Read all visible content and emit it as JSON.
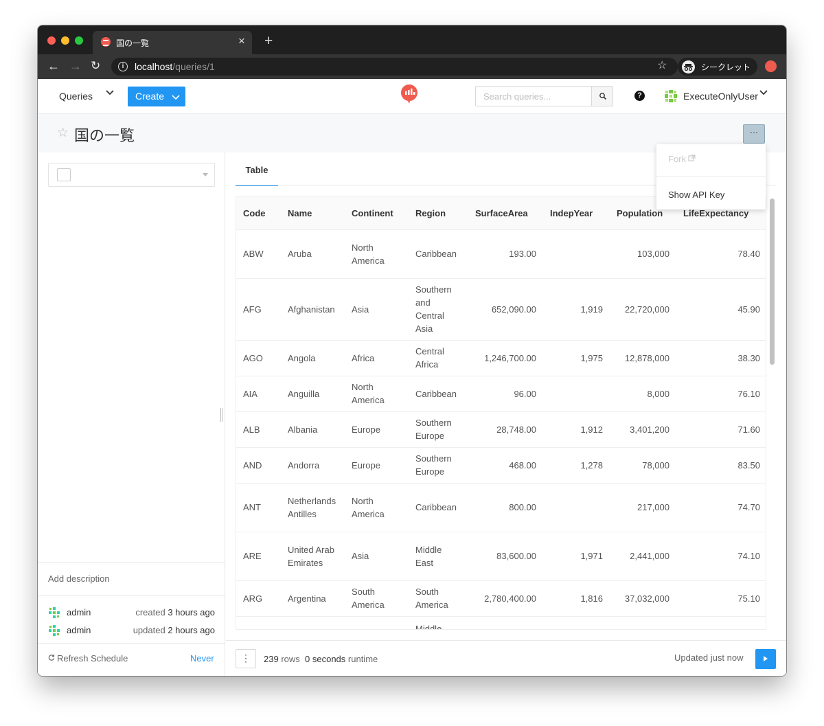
{
  "browser": {
    "tab_title": "国の一覧",
    "tab_close": "×",
    "new_tab": "+",
    "url_host": "localhost",
    "url_path": "/queries/1",
    "incognito_label": "シークレット"
  },
  "header": {
    "queries_label": "Queries",
    "create_label": "Create",
    "search_placeholder": "Search queries...",
    "help_glyph": "?",
    "user_name": "ExecuteOnlyUser"
  },
  "query": {
    "title": "国の一覧",
    "more_label": "···",
    "menu": {
      "fork": "Fork",
      "show_api_key": "Show API Key"
    }
  },
  "sidebar": {
    "add_description": "Add description",
    "created": {
      "user": "admin",
      "action": "created",
      "time": "3 hours ago"
    },
    "updated": {
      "user": "admin",
      "action": "updated",
      "time": "2 hours ago"
    },
    "refresh_label": "Refresh Schedule",
    "refresh_value": "Never"
  },
  "results": {
    "tab_label": "Table",
    "columns": [
      "Code",
      "Name",
      "Continent",
      "Region",
      "SurfaceArea",
      "IndepYear",
      "Population",
      "LifeExpectancy"
    ],
    "rows": [
      [
        "ABW",
        "Aruba",
        "North America",
        "Caribbean",
        "193.00",
        "",
        "103,000",
        "78.40"
      ],
      [
        "AFG",
        "Afghanistan",
        "Asia",
        "Southern and Central Asia",
        "652,090.00",
        "1,919",
        "22,720,000",
        "45.90"
      ],
      [
        "AGO",
        "Angola",
        "Africa",
        "Central Africa",
        "1,246,700.00",
        "1,975",
        "12,878,000",
        "38.30"
      ],
      [
        "AIA",
        "Anguilla",
        "North America",
        "Caribbean",
        "96.00",
        "",
        "8,000",
        "76.10"
      ],
      [
        "ALB",
        "Albania",
        "Europe",
        "Southern Europe",
        "28,748.00",
        "1,912",
        "3,401,200",
        "71.60"
      ],
      [
        "AND",
        "Andorra",
        "Europe",
        "Southern Europe",
        "468.00",
        "1,278",
        "78,000",
        "83.50"
      ],
      [
        "ANT",
        "Netherlands Antilles",
        "North America",
        "Caribbean",
        "800.00",
        "",
        "217,000",
        "74.70"
      ],
      [
        "ARE",
        "United Arab Emirates",
        "Asia",
        "Middle East",
        "83,600.00",
        "1,971",
        "2,441,000",
        "74.10"
      ],
      [
        "ARG",
        "Argentina",
        "South America",
        "South America",
        "2,780,400.00",
        "1,816",
        "37,032,000",
        "75.10"
      ],
      [
        "",
        "",
        "",
        "Middle",
        "",
        "",
        "",
        ""
      ]
    ],
    "row_count": "239",
    "rows_word": "rows",
    "runtime": "0 seconds",
    "runtime_word": "runtime",
    "updated": "Updated just now"
  },
  "colors": {
    "accent": "#2196f3",
    "logo": "#f05b4f",
    "user_avatar": "#7ac943",
    "admin_avatar": "#2bd4a8"
  }
}
